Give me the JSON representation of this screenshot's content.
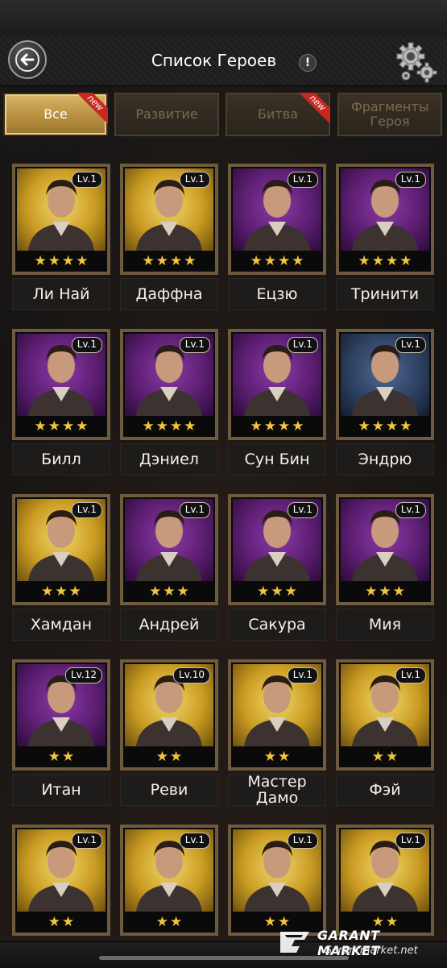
{
  "header": {
    "title": "Список Героев",
    "info_symbol": "!"
  },
  "tabs": [
    {
      "label": "Все",
      "active": true,
      "new": true
    },
    {
      "label": "Развитие",
      "active": false,
      "new": false
    },
    {
      "label": "Битва",
      "active": false,
      "new": true
    },
    {
      "label": "Фрагменты Героя",
      "active": false,
      "new": false
    }
  ],
  "new_badge_text": "new",
  "star_glyph": "★",
  "heroes": [
    {
      "name": "Ли Най",
      "level": "Lv.1",
      "stars": 4,
      "bg": "gold"
    },
    {
      "name": "Даффна",
      "level": "Lv.1",
      "stars": 4,
      "bg": "gold"
    },
    {
      "name": "Ецзю",
      "level": "Lv.1",
      "stars": 4,
      "bg": "purple"
    },
    {
      "name": "Тринити",
      "level": "Lv.1",
      "stars": 4,
      "bg": "purple"
    },
    {
      "name": "Билл",
      "level": "Lv.1",
      "stars": 4,
      "bg": "purple"
    },
    {
      "name": "Дэниел",
      "level": "Lv.1",
      "stars": 4,
      "bg": "purple"
    },
    {
      "name": "Сун Бин",
      "level": "Lv.1",
      "stars": 4,
      "bg": "purple"
    },
    {
      "name": "Эндрю",
      "level": "Lv.1",
      "stars": 4,
      "bg": "blue"
    },
    {
      "name": "Хамдан",
      "level": "Lv.1",
      "stars": 3,
      "bg": "gold"
    },
    {
      "name": "Андрей",
      "level": "Lv.1",
      "stars": 3,
      "bg": "purple"
    },
    {
      "name": "Сакура",
      "level": "Lv.1",
      "stars": 3,
      "bg": "purple"
    },
    {
      "name": "Мия",
      "level": "Lv.1",
      "stars": 3,
      "bg": "purple"
    },
    {
      "name": "Итан",
      "level": "Lv.12",
      "stars": 2,
      "bg": "purple"
    },
    {
      "name": "Реви",
      "level": "Lv.10",
      "stars": 2,
      "bg": "gold"
    },
    {
      "name": "Мастер Дамо",
      "level": "Lv.1",
      "stars": 2,
      "bg": "gold"
    },
    {
      "name": "Фэй",
      "level": "Lv.1",
      "stars": 2,
      "bg": "gold"
    },
    {
      "name": "",
      "level": "Lv.1",
      "stars": 2,
      "bg": "gold"
    },
    {
      "name": "",
      "level": "Lv.1",
      "stars": 2,
      "bg": "gold"
    },
    {
      "name": "",
      "level": "Lv.1",
      "stars": 2,
      "bg": "gold"
    },
    {
      "name": "",
      "level": "Lv.1",
      "stars": 2,
      "bg": "gold"
    }
  ],
  "watermark": {
    "name": "GARANT MARKET",
    "url": "Garantmarket.net"
  },
  "colors": {
    "star": "#f3c53d",
    "active_tab": "#d9b66a",
    "new_badge": "#c8281e"
  }
}
